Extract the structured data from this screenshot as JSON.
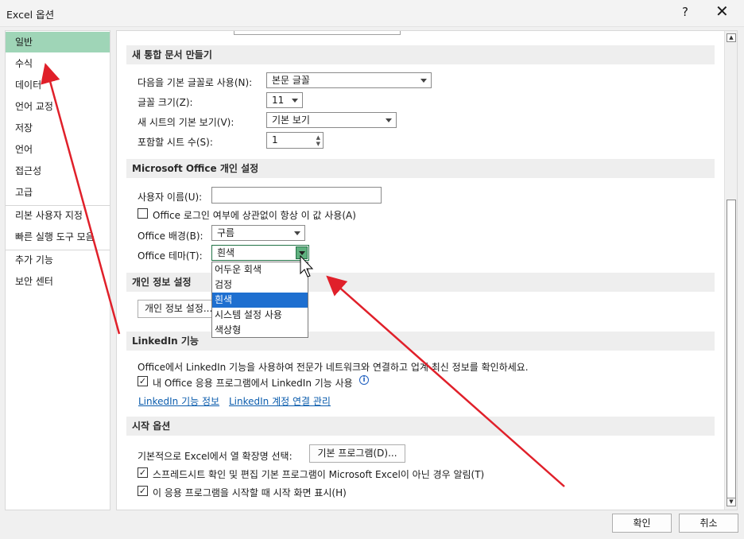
{
  "window": {
    "title": "Excel 옵션",
    "help_glyph": "?",
    "close_glyph": "✕"
  },
  "nav": {
    "items": [
      {
        "label": "일반"
      },
      {
        "label": "수식"
      },
      {
        "label": "데이터"
      },
      {
        "label": "언어 교정"
      },
      {
        "label": "저장"
      },
      {
        "label": "언어"
      },
      {
        "label": "접근성"
      },
      {
        "label": "고급"
      },
      {
        "label": "리본 사용자 지정"
      },
      {
        "label": "빠른 실행 도구 모음"
      },
      {
        "label": "추가 기능"
      },
      {
        "label": "보안 센터"
      }
    ],
    "selected": "일반"
  },
  "sections": {
    "new_workbook": {
      "title": "새 통합 문서 만들기",
      "default_font_label": "다음을 기본 글꼴로 사용(N):",
      "default_font_value": "본문 글꼴",
      "font_size_label": "글꼴 크기(Z):",
      "font_size_value": "11",
      "default_view_label": "새 시트의 기본 보기(V):",
      "default_view_value": "기본 보기",
      "sheet_count_label": "포함할 시트 수(S):",
      "sheet_count_value": "1"
    },
    "personalize": {
      "title": "Microsoft Office 개인 설정",
      "username_label": "사용자 이름(U):",
      "always_use_label": "Office 로그인 여부에 상관없이 항상 이 값 사용(A)",
      "always_use_checked": false,
      "background_label": "Office 배경(B):",
      "background_value": "구름",
      "theme_label": "Office 테마(T):",
      "theme_value": "흰색",
      "theme_options": [
        "어두운 회색",
        "검정",
        "흰색",
        "시스템 설정 사용",
        "색상형"
      ],
      "theme_selected": "흰색"
    },
    "privacy": {
      "title": "개인 정보 설정",
      "button_label": "개인 정보 설정..."
    },
    "linkedin": {
      "title": "LinkedIn 기능",
      "description": "Office에서 LinkedIn 기능을 사용하여 전문가 네트워크와 연결하고 업계 최신 정보를 확인하세요.",
      "enable_label": "내 Office 응용 프로그램에서 LinkedIn 기능 사용",
      "enable_checked": true,
      "link_about": "LinkedIn 기능 정보",
      "link_manage": "LinkedIn 계정 연결 관리"
    },
    "startup": {
      "title": "시작 옵션",
      "extensions_label": "기본적으로 Excel에서 열 확장명 선택:",
      "default_programs_button": "기본 프로그램(D)...",
      "notify_label": "스프레드시트 확인 및 편집 기본 프로그램이 Microsoft Excel이 아닌 경우 알림(T)",
      "notify_checked": true,
      "show_start_label": "이 응용 프로그램을 시작할 때 시작 화면 표시(H)",
      "show_start_checked": true
    }
  },
  "footer": {
    "ok_label": "확인",
    "cancel_label": "취소"
  },
  "annotation": {
    "arrow_color": "#e0202a"
  },
  "colors": {
    "nav_selected": "#9fd5b7",
    "dropdown_selected": "#1e6fd0",
    "link": "#0b5cad"
  }
}
